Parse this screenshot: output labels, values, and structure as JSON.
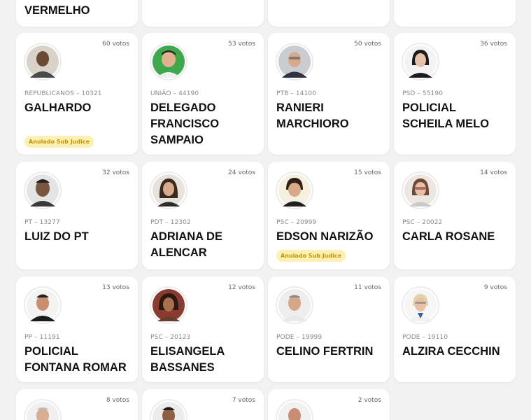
{
  "top_partial": {
    "name": "VERMELHO"
  },
  "candidates": [
    {
      "votes": "60 votos",
      "party": "REPUBLICANOS – 10321",
      "name": "GALHARDO",
      "badge": "Anulado Sub Judice",
      "avatar": "person-photo-icon"
    },
    {
      "votes": "53 votos",
      "party": "UNIÃO – 44190",
      "name": "DELEGADO FRANCISCO SAMPAIO",
      "badge": "",
      "avatar": "person-photo-icon"
    },
    {
      "votes": "50 votos",
      "party": "PTB – 14100",
      "name": "RANIERI MARCHIORO",
      "badge": "",
      "avatar": "person-photo-icon"
    },
    {
      "votes": "36 votos",
      "party": "PSD – 55190",
      "name": "POLICIAL SCHEILA MELO",
      "badge": "",
      "avatar": "person-photo-icon"
    },
    {
      "votes": "32 votos",
      "party": "PT – 13277",
      "name": "LUIZ DO PT",
      "badge": "",
      "avatar": "person-photo-icon"
    },
    {
      "votes": "24 votos",
      "party": "PDT – 12302",
      "name": "ADRIANA DE ALENCAR",
      "badge": "",
      "avatar": "person-photo-icon"
    },
    {
      "votes": "15 votos",
      "party": "PSC – 20999",
      "name": "EDSON NARIZÃO",
      "badge": "Anulado Sub Judice",
      "avatar": "person-photo-icon"
    },
    {
      "votes": "14 votos",
      "party": "PSC – 20022",
      "name": "CARLA ROSANE",
      "badge": "",
      "avatar": "person-photo-icon"
    },
    {
      "votes": "13 votos",
      "party": "PP – 11191",
      "name": "POLICIAL FONTANA ROMAR",
      "badge": "",
      "avatar": "person-photo-icon"
    },
    {
      "votes": "12 votos",
      "party": "PSC – 20123",
      "name": "ELISANGELA BASSANES",
      "badge": "",
      "avatar": "person-photo-icon"
    },
    {
      "votes": "11 votos",
      "party": "PODE – 19999",
      "name": "CELINO FERTRIN",
      "badge": "",
      "avatar": "person-photo-icon"
    },
    {
      "votes": "9 votos",
      "party": "PODE – 19110",
      "name": "ALZIRA CECCHIN",
      "badge": "",
      "avatar": "person-photo-icon"
    },
    {
      "votes": "8 votos",
      "party": "",
      "name": "",
      "badge": "",
      "avatar": "person-photo-icon"
    },
    {
      "votes": "7 votos",
      "party": "",
      "name": "",
      "badge": "",
      "avatar": "person-photo-icon"
    },
    {
      "votes": "2 votos",
      "party": "",
      "name": "",
      "badge": "",
      "avatar": "person-photo-icon"
    }
  ]
}
